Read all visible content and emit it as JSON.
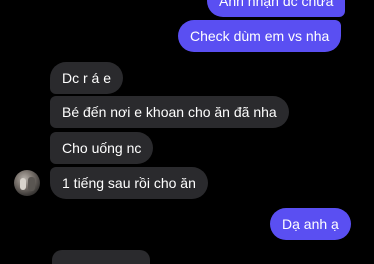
{
  "chat": {
    "sent_top_partial": "Anh nhận dc chưa",
    "sent_check": "Check dùm em vs nha",
    "recv_1": "Dc r á e",
    "recv_2": "Bé đến nơi e khoan cho ăn đã nha",
    "recv_3": "Cho uống nc",
    "recv_4": "1 tiếng sau rồi cho ăn",
    "sent_reply": "Dạ anh ạ"
  },
  "colors": {
    "background": "#000000",
    "sent_bubble": "#5a4ff2",
    "received_bubble": "#2a2a2d",
    "text": "#ffffff"
  },
  "icons": {
    "avatar": "contact-avatar-photo"
  }
}
